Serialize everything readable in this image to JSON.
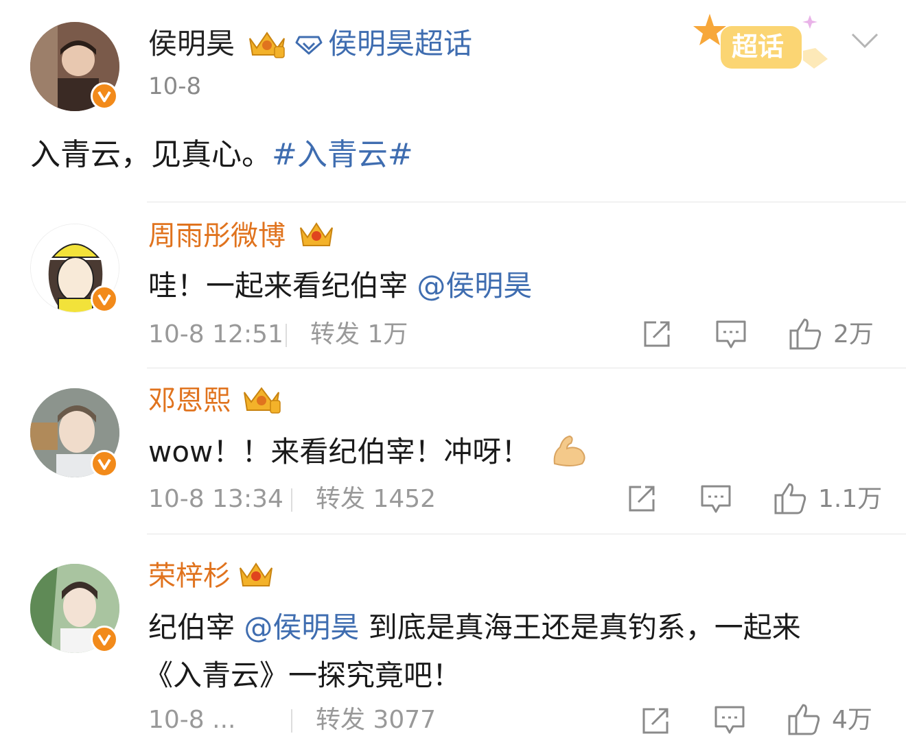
{
  "post": {
    "author": "侯明昊",
    "supertopic": "侯明昊超话",
    "date": "10-8",
    "text": "入青云，见真心。",
    "hashtag": "#入青云#",
    "supertopic_badge": "超话"
  },
  "comments": [
    {
      "name": "周雨彤微博",
      "text_before": "哇！一起来看纪伯宰",
      "mention": "@侯明昊",
      "text_after": "",
      "time": "10-8 12:51",
      "repost": "转发 1万",
      "likes": "2万"
    },
    {
      "name": "邓恩熙",
      "text_before": "wow！！来看纪伯宰！冲呀！",
      "mention": "",
      "text_after": "",
      "time": "10-8 13:34",
      "repost": "转发 1452",
      "likes": "1.1万"
    },
    {
      "name": "荣梓杉",
      "text_before": "纪伯宰",
      "mention": "@侯明昊",
      "text_after": "到底是真海王还是真钓系，一起来",
      "line2": "《入青云》一探究竟吧！",
      "time": "10-8 ...",
      "repost": "转发 3077",
      "likes": "4万"
    }
  ],
  "colors": {
    "orange_name": "#e0731e",
    "link_blue": "#3f6db0",
    "badge_orange": "#f28a1a"
  },
  "icons": [
    "crown-icon",
    "diamond-icon",
    "verified-icon",
    "chevron-down-icon",
    "share-icon",
    "comment-icon",
    "thumb-up-icon",
    "flex-emoji-icon"
  ]
}
